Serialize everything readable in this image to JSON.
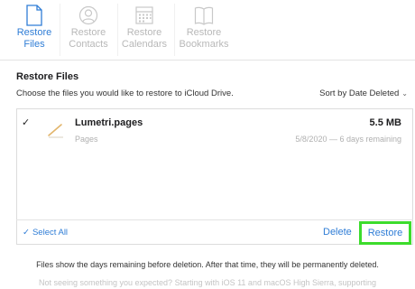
{
  "tabs": [
    {
      "line1": "Restore",
      "line2": "Files",
      "icon": "document-icon",
      "active": true
    },
    {
      "line1": "Restore",
      "line2": "Contacts",
      "icon": "contact-icon",
      "active": false
    },
    {
      "line1": "Restore",
      "line2": "Calendars",
      "icon": "calendar-icon",
      "active": false
    },
    {
      "line1": "Restore",
      "line2": "Bookmarks",
      "icon": "bookmarks-icon",
      "active": false
    }
  ],
  "section": {
    "title": "Restore Files",
    "subtitle": "Choose the files you would like to restore to iCloud Drive.",
    "sort_label": "Sort by Date Deleted"
  },
  "files": [
    {
      "name": "Lumetri.pages",
      "kind": "Pages",
      "size": "5.5 MB",
      "date": "5/8/2020 — 6 days remaining",
      "checked": true
    }
  ],
  "footer": {
    "select_all": "Select All",
    "delete": "Delete",
    "restore": "Restore"
  },
  "info": {
    "main": "Files show the days remaining before deletion. After that time, they will be permanently deleted.",
    "faint": "Not seeing something you expected? Starting with iOS 11 and macOS High Sierra, supporting"
  },
  "colors": {
    "accent": "#2f7dd6",
    "highlight": "#3cdc2c",
    "inactive": "#b8b8b8"
  }
}
